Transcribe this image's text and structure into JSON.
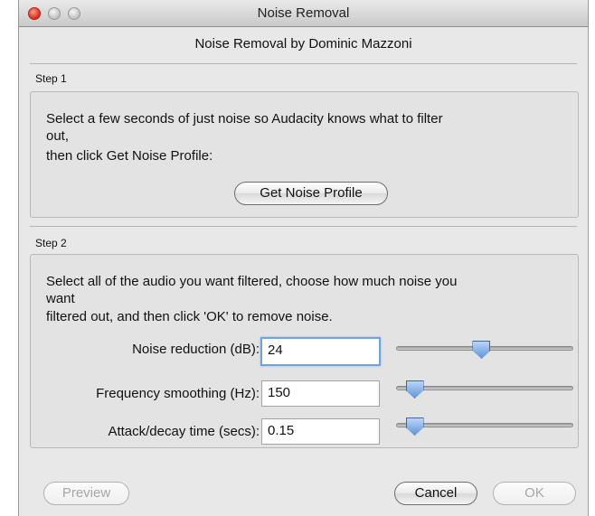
{
  "window": {
    "title": "Noise Removal",
    "heading": "Noise Removal by Dominic Mazzoni"
  },
  "step1": {
    "label": "Step 1",
    "text_line1": "Select a few seconds of just noise so Audacity knows what to filter",
    "text_line2": "out,",
    "text_line3": "then click Get Noise Profile:",
    "button_label": "Get Noise Profile"
  },
  "step2": {
    "label": "Step 2",
    "text_line1": "Select all of the audio you want filtered, choose how much noise you",
    "text_line2": "want",
    "text_line3": "filtered out, and then click 'OK' to remove noise.",
    "controls": [
      {
        "label": "Noise reduction (dB):",
        "value": "24",
        "slider_fraction": 0.48
      },
      {
        "label": "Frequency smoothing (Hz):",
        "value": "150",
        "slider_fraction": 0.06
      },
      {
        "label": "Attack/decay time (secs):",
        "value": "0.15",
        "slider_fraction": 0.06
      }
    ]
  },
  "footer": {
    "preview_label": "Preview",
    "cancel_label": "Cancel",
    "ok_label": "OK"
  },
  "colors": {
    "window_bg": "#e8e8e8",
    "slider_thumb": "#5f96dd",
    "focus_ring": "#6fa2e0"
  }
}
